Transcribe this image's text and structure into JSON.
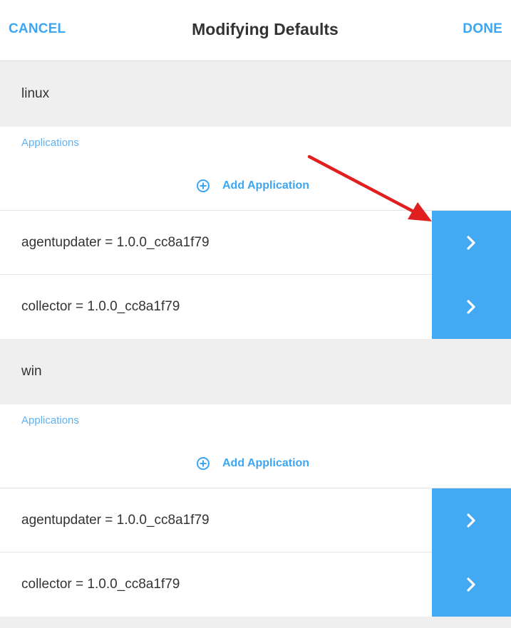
{
  "header": {
    "cancel_label": "CANCEL",
    "title": "Modifying Defaults",
    "done_label": "DONE"
  },
  "groups": [
    {
      "name": "linux",
      "apps_label": "Applications",
      "add_label": "Add Application",
      "apps": [
        {
          "text": "agentupdater = 1.0.0_cc8a1f79"
        },
        {
          "text": "collector = 1.0.0_cc8a1f79"
        }
      ]
    },
    {
      "name": "win",
      "apps_label": "Applications",
      "add_label": "Add Application",
      "apps": [
        {
          "text": "agentupdater = 1.0.0_cc8a1f79"
        },
        {
          "text": "collector = 1.0.0_cc8a1f79"
        }
      ]
    }
  ],
  "colors": {
    "accent": "#3aa6f4",
    "row_button": "#43a9f3",
    "section_bg": "#efefef",
    "annotation_arrow": "#e02020"
  },
  "icons": {
    "add": "plus-circle-icon",
    "row": "chevron-right-icon",
    "annotation": "red-arrow-annotation"
  }
}
